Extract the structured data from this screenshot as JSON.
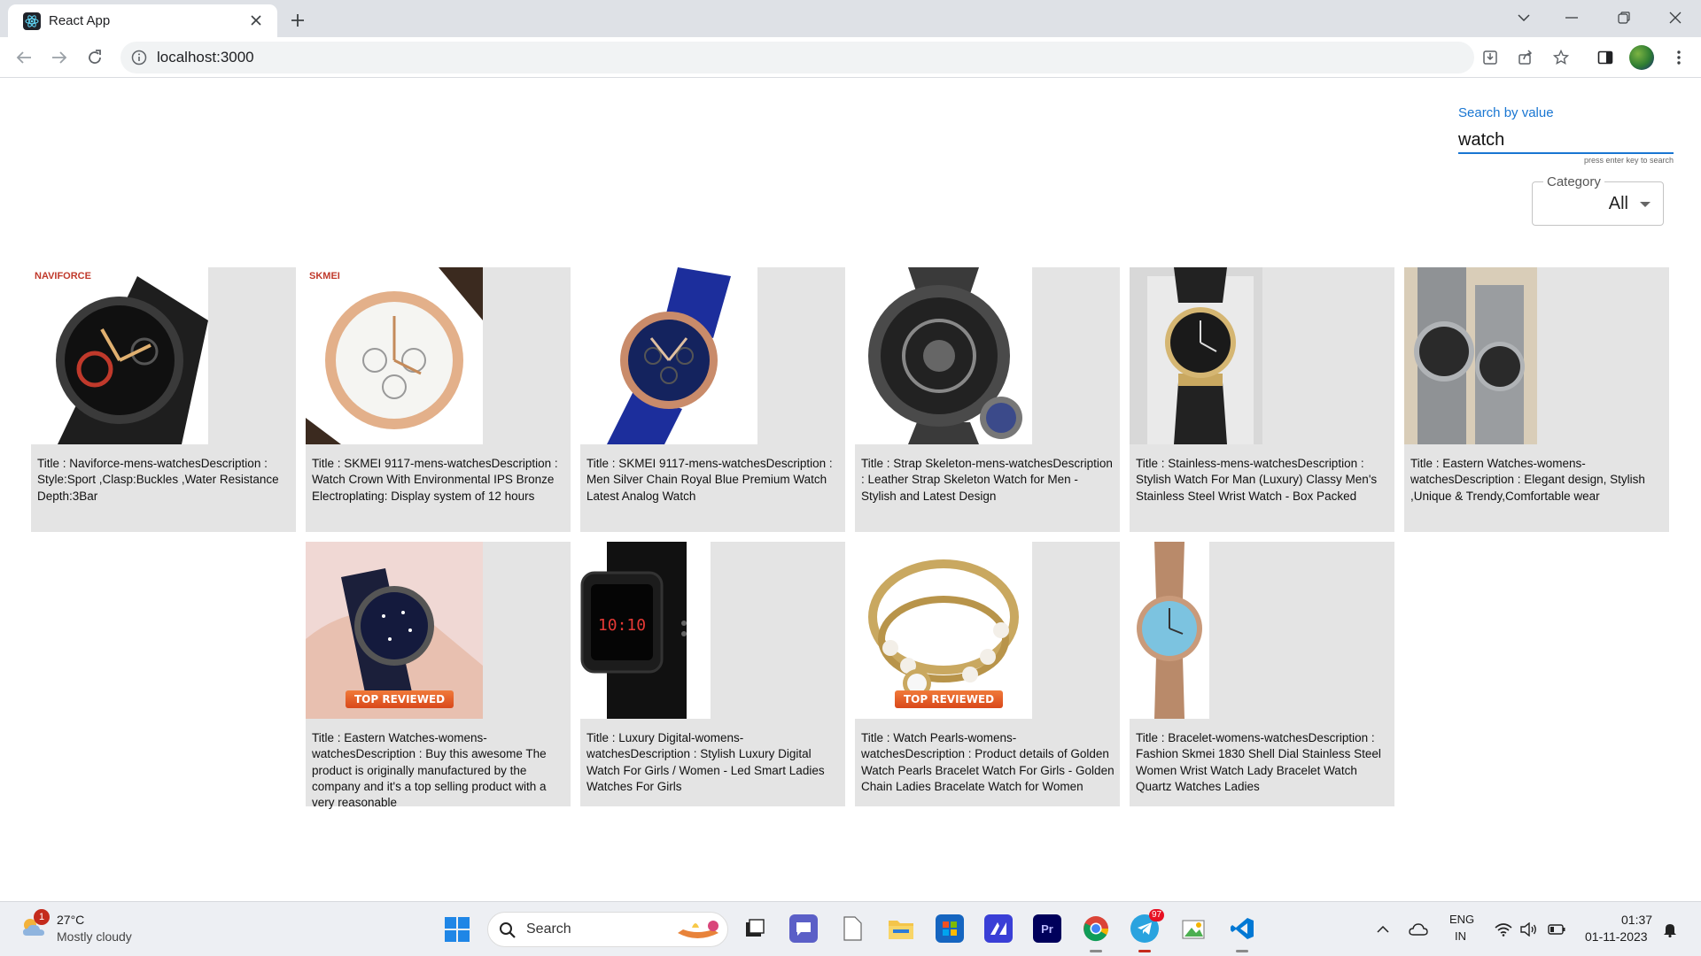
{
  "browser": {
    "tab_title": "React App",
    "url": "localhost:3000"
  },
  "search": {
    "label": "Search by value",
    "value": "watch",
    "helper": "press enter key to search"
  },
  "category": {
    "label": "Category",
    "value": "All"
  },
  "products": [
    {
      "text": "Title : Naviforce-mens-watchesDescription : Style:Sport ,Clasp:Buckles ,Water Resistance Depth:3Bar",
      "brand": "NAVIFORCE"
    },
    {
      "text": "Title : SKMEI 9117-mens-watchesDescription : Watch Crown With Environmental IPS Bronze Electroplating: Display system of 12 hours",
      "brand": "SKMEI"
    },
    {
      "text": "Title : SKMEI 9117-mens-watchesDescription : Men Silver Chain Royal Blue Premium Watch Latest Analog Watch"
    },
    {
      "text": "Title : Strap Skeleton-mens-watchesDescription : Leather Strap Skeleton Watch for Men - Stylish and Latest Design"
    },
    {
      "text": "Title : Stainless-mens-watchesDescription : Stylish Watch For Man (Luxury) Classy Men's Stainless Steel Wrist Watch - Box Packed"
    },
    {
      "text": "Title : Eastern Watches-womens-watchesDescription : Elegant design, Stylish ,Unique & Trendy,Comfortable wear"
    },
    {
      "text": "Title : Eastern Watches-womens-watchesDescription : Buy this awesome The product is originally manufactured by the company and it's a top selling product with a very reasonable",
      "badge": "TOP REVIEWED"
    },
    {
      "text": "Title : Luxury Digital-womens-watchesDescription : Stylish Luxury Digital Watch For Girls / Women - Led Smart Ladies Watches For Girls",
      "display": "10:10"
    },
    {
      "text": "Title : Watch Pearls-womens-watchesDescription : Product details of Golden Watch Pearls Bracelet Watch For Girls - Golden Chain Ladies Bracelate Watch for Women",
      "badge": "TOP REVIEWED"
    },
    {
      "text": "Title : Bracelet-womens-watchesDescription : Fashion Skmei 1830 Shell Dial Stainless Steel Women Wrist Watch Lady Bracelet Watch Quartz Watches Ladies"
    }
  ],
  "taskbar": {
    "weather_temp": "27°C",
    "weather_desc": "Mostly cloudy",
    "weather_badge": "1",
    "search_text": "Search",
    "telegram_badge": "97",
    "lang_top": "ENG",
    "lang_bottom": "IN",
    "time": "01:37",
    "date": "01-11-2023"
  },
  "colors": {
    "accent": "#1976d2",
    "card_bg": "#e4e4e4",
    "chrome_tabbar": "#dee1e6",
    "taskbar_bg": "#edeff3"
  }
}
